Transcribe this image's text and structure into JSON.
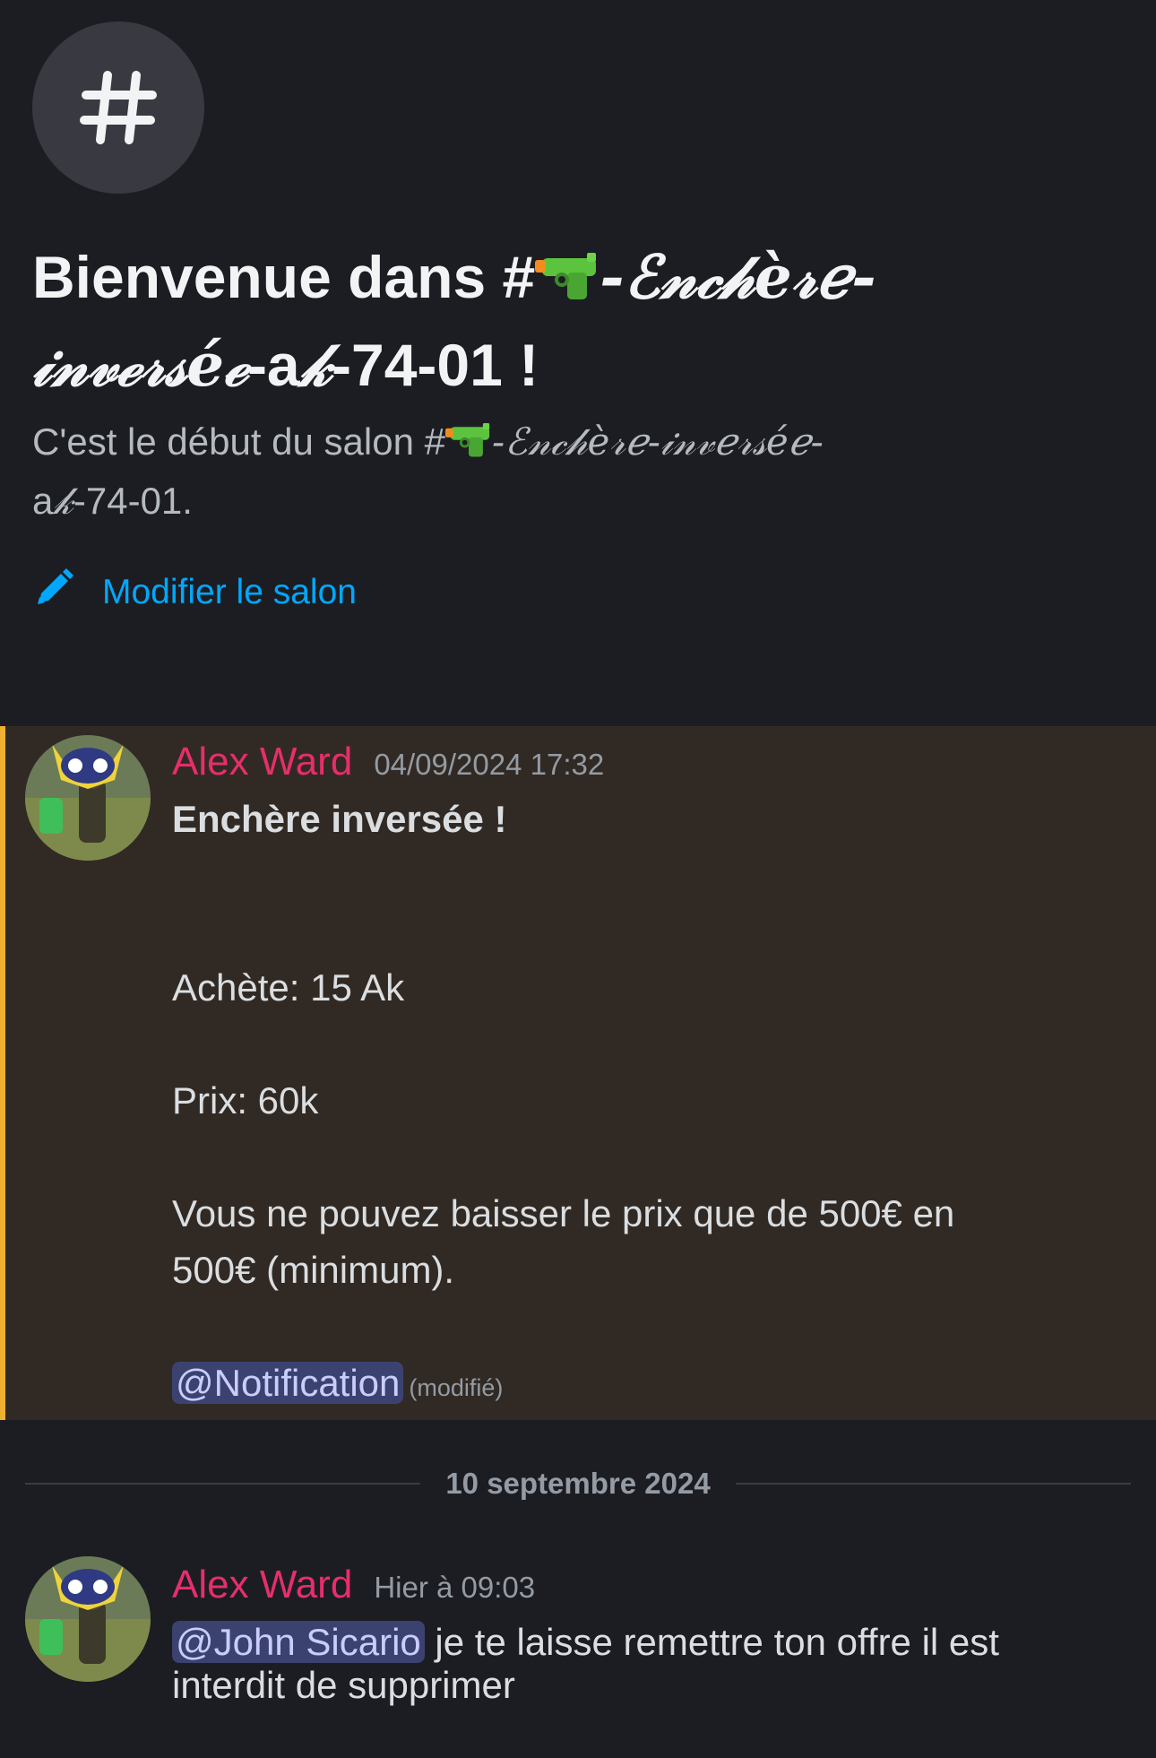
{
  "channel": {
    "icon": "hash-icon",
    "welcome_prefix": "Bienvenue dans #",
    "welcome_name_fancy": "-ℰ𝓃𝒸𝒽è𝓇ℯ-",
    "welcome_name_fancy2": "𝒾𝓃𝓋ℯ𝓇𝓈éℯ",
    "welcome_name_mid": "-a",
    "welcome_name_fancy3": "𝓀",
    "welcome_suffix": "-74-01 !",
    "subtitle_prefix": "C'est le début du salon #",
    "subtitle_fancy": "-ℰ𝓃𝒸𝒽è𝓇ℯ-𝒾𝓃𝓋ℯ𝓇𝓈éℯ-",
    "subtitle_mid": "a",
    "subtitle_fancy2": "𝓀",
    "subtitle_suffix": "-74-01.",
    "edit_label": "Modifier le salon"
  },
  "messages": [
    {
      "author": "Alex Ward",
      "timestamp": "04/09/2024 17:32",
      "title": "Enchère inversée !",
      "line1": "Achète: 15 Ak",
      "line2": "Prix: 60k",
      "line3a": "Vous ne pouvez baisser le prix que de 500€ en",
      "line3b": "500€ (minimum).",
      "mention": "@Notification",
      "edited": "(modifié)"
    },
    {
      "author": "Alex Ward",
      "timestamp": "Hier à 09:03",
      "mention": "@John Sicario",
      "text_a": " je te laisse remettre ton offre il est",
      "text_b": "interdit de supprimer"
    }
  ],
  "divider": {
    "date": "10 septembre 2024"
  },
  "colors": {
    "background": "#1c1d22",
    "highlight_bg": "#312a24",
    "highlight_bar": "#f0b132",
    "username": "#e62e6b",
    "link": "#00a8fc",
    "mention_bg": "#3c4270"
  }
}
